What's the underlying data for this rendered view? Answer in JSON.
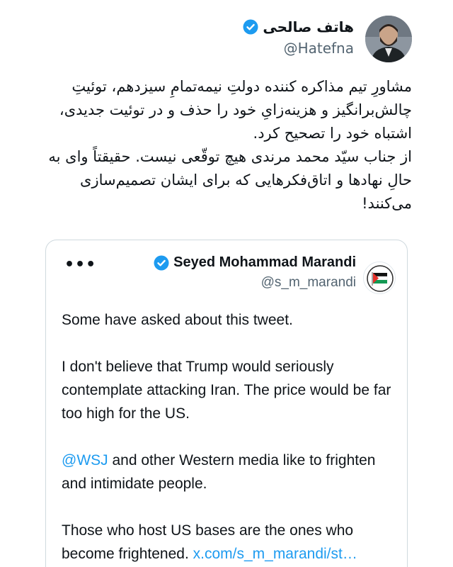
{
  "author": {
    "display_name": "هاتف صالحی",
    "handle": "@Hatefna",
    "verified_color": "#1d9bf0"
  },
  "tweet": {
    "paragraph1": "مشاورِ تیم مذاکره کننده دولتِ نیمه‌تمامِ سیزدهم، توئیتِ چالش‌برانگیز و هزینه‌زایِ خود را حذف و در توئیت جدیدی، اشتباه خود را تصحیح کرد.",
    "paragraph2": "از جناب سیّد محمد مرندی هیچ توقّعی نیست. حقیقتاً وای به حالِ نهادها و اتاق‌فکرهایی که برای ایشان تصمیم‌سازی می‌کنند!"
  },
  "quote": {
    "more_icon": "•••",
    "display_name": "Seyed Mohammad Marandi",
    "handle": "@s_m_marandi",
    "p1": "Some have asked about this tweet.",
    "p2": "I don't believe that Trump would seriously contemplate attacking Iran. The price would be far too high for the US.",
    "p3_mention": "@WSJ",
    "p3_rest": " and other Western media like to frighten and intimidate people.",
    "p4": "Those who host US bases are the ones who become frightened. ",
    "p4_link": "x.com/s_m_marandi/st…"
  }
}
